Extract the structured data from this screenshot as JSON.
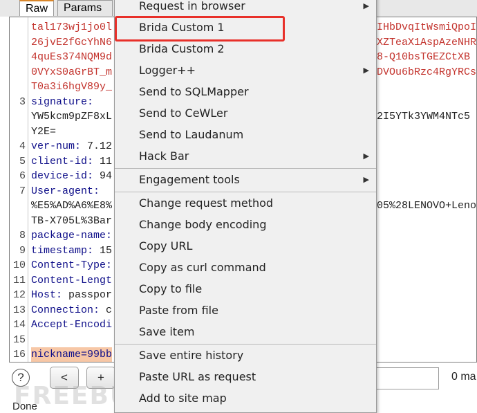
{
  "tabs": {
    "raw": "Raw",
    "params": "Params"
  },
  "editor": {
    "lines": [
      {
        "n": "",
        "left": "tal173wj1jo0l",
        "right": "IHbDvqItWsmiQpoI",
        "left_color": "red"
      },
      {
        "n": "",
        "left": "26jvE2fGcYhN6",
        "right": "XZTeaX1AspAzeNHR",
        "left_color": "red"
      },
      {
        "n": "",
        "left": "4quEs374NQM9d",
        "right": "8-Q10bsTGEZCtXB",
        "left_color": "red"
      },
      {
        "n": "",
        "left": "0VYxS0aGrBT_m",
        "right": "DVOu6bRzc4RgYRCs",
        "left_color": "red"
      },
      {
        "n": "",
        "left": "T0a3i6hgV89y_",
        "right": "",
        "left_color": "red"
      },
      {
        "n": "3",
        "key": "signature:",
        "val": ""
      },
      {
        "n": "",
        "left": "YW5kcm9pZF8xL",
        "right": "2I5YTk3YWM4NTc5",
        "left_color": "black"
      },
      {
        "n": "",
        "left": "Y2E=",
        "right": "",
        "left_color": "black"
      },
      {
        "n": "4",
        "key": "ver-num:",
        "val": " 7.12"
      },
      {
        "n": "5",
        "key": "client-id:",
        "val": " 11"
      },
      {
        "n": "6",
        "key": "device-id:",
        "val": " 94"
      },
      {
        "n": "7",
        "key": "User-agent:",
        "val": ""
      },
      {
        "n": "",
        "left": "%E5%AD%A6%E8%",
        "right": "05%28LENOVO+Leno",
        "left_color": "black"
      },
      {
        "n": "",
        "left": "TB-X705L%3Bar",
        "right": "",
        "left_color": "black"
      },
      {
        "n": "8",
        "key": "package-name:",
        "val": ""
      },
      {
        "n": "9",
        "key": "timestamp:",
        "val": " 15"
      },
      {
        "n": "10",
        "key": "Content-Type:",
        "val": ""
      },
      {
        "n": "11",
        "key": "Content-Lengt",
        "val": ""
      },
      {
        "n": "12",
        "key": "Host:",
        "val": " passpor"
      },
      {
        "n": "13",
        "key": "Connection:",
        "val": " c"
      },
      {
        "n": "14",
        "key": "Accept-Encodi",
        "val": ""
      },
      {
        "n": "15",
        "key": "",
        "val": ""
      },
      {
        "n": "16",
        "key": "nickname=99bb",
        "val": "",
        "highlight": true
      }
    ]
  },
  "menu": {
    "items": [
      {
        "label": "Request in browser",
        "arrow": true
      },
      {
        "label": "Brida Custom 1",
        "arrow": false
      },
      {
        "label": "Brida Custom 2",
        "arrow": false
      },
      {
        "label": "Logger++",
        "arrow": true
      },
      {
        "label": "Send to SQLMapper",
        "arrow": false
      },
      {
        "label": "Send to CeWLer",
        "arrow": false
      },
      {
        "label": "Send to Laudanum",
        "arrow": false
      },
      {
        "label": "Hack Bar",
        "arrow": true
      },
      {
        "label": "Engagement tools",
        "arrow": true
      },
      {
        "label": "Change request method",
        "arrow": false
      },
      {
        "label": "Change body encoding",
        "arrow": false
      },
      {
        "label": "Copy URL",
        "arrow": false
      },
      {
        "label": "Copy as curl command",
        "arrow": false
      },
      {
        "label": "Copy to file",
        "arrow": false
      },
      {
        "label": "Paste from file",
        "arrow": false
      },
      {
        "label": "Save item",
        "arrow": false
      },
      {
        "label": "Save entire history",
        "arrow": false
      },
      {
        "label": "Paste URL as request",
        "arrow": false
      },
      {
        "label": "Add to site map",
        "arrow": false
      }
    ],
    "arrow_glyph": "▶",
    "highlighted_item": "Brida Custom 1",
    "highlight_color": "#e8302a"
  },
  "bottom": {
    "help": "?",
    "prev": "<",
    "next": "+",
    "search_value": "",
    "matches": "0 ma",
    "status": "Done"
  },
  "watermark": "FREEBUF",
  "colors": {
    "key": "#10108a",
    "red_text": "#c3332d",
    "highlight_bg": "#f7c7a6",
    "tab_accent": "#d9862a"
  }
}
